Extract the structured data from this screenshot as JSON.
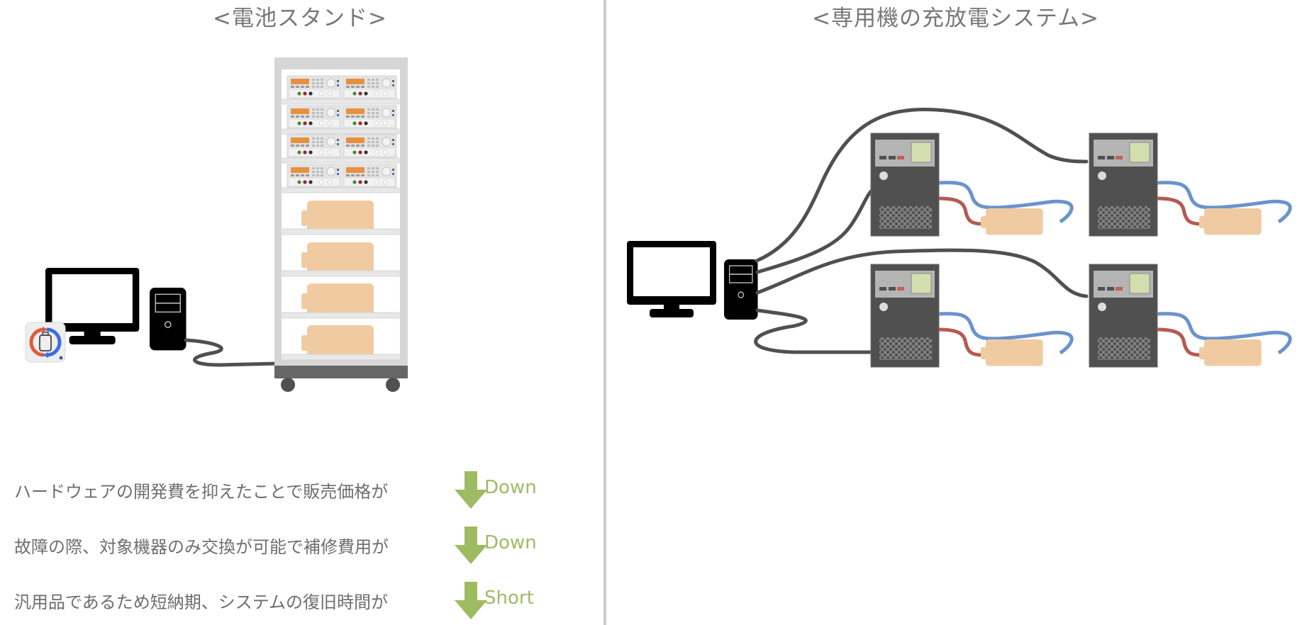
{
  "left_panel": {
    "title": "<電池スタンド>",
    "components": [
      "app-icon",
      "monitor",
      "pc-tower",
      "battery-stand-rack"
    ],
    "rack": {
      "instrument_rows": 4,
      "instruments_per_row": 2,
      "battery_shelves": 4
    }
  },
  "right_panel": {
    "title": "<専用機の充放電システム>",
    "components": [
      "monitor",
      "pc-tower",
      "dedicated-charger-units"
    ],
    "charger_units": 4
  },
  "benefits": [
    {
      "text": "ハードウェアの開発費を抑えたことで販売価格が",
      "direction": "down-arrow",
      "result": "Down"
    },
    {
      "text": "故障の際、対象機器のみ交換が可能で補修費用が",
      "direction": "down-arrow",
      "result": "Down"
    },
    {
      "text": "汎用品であるため短納期、システムの復旧時間が",
      "direction": "down-arrow",
      "result": "Short"
    }
  ],
  "colors": {
    "title_text": "#777777",
    "body_text": "#6e6e6e",
    "accent_green": "#9fbb62",
    "battery": "#f0cba2",
    "charger_body": "#505050",
    "charger_panel": "#b4b4b4",
    "charger_screen": "#d3ddae",
    "cable_dark": "#505050",
    "cable_blue": "#6b93cc",
    "cable_red": "#b55a52",
    "divider": "#cccccc"
  }
}
